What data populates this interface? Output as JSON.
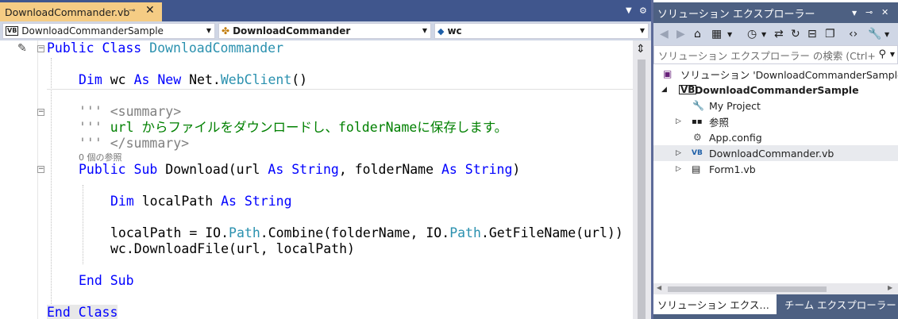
{
  "editor": {
    "tab": {
      "label": "DownloadCommander.vb",
      "pin_glyph": "⊸",
      "close_glyph": "✕"
    },
    "tabstrip_buttons": {
      "dropdown": "▼",
      "settings": "⚙"
    },
    "navbar": {
      "project_combo": "DownloadCommanderSample",
      "type_combo": "DownloadCommander",
      "member_combo": "wc"
    },
    "code": {
      "line1": {
        "kw": "Public Class",
        "type": "DownloadCommander"
      },
      "line2": {
        "kw1": "Dim",
        "var": " wc ",
        "kw2": "As New",
        "ns": " Net.",
        "type": "WebClient",
        "tail": "()"
      },
      "doc1": {
        "marker": "'''",
        "tag": " <summary>"
      },
      "doc2": {
        "marker": "'''",
        "text": " url からファイルをダウンロードし、folderNameに保存します。"
      },
      "doc3": {
        "marker": "'''",
        "tag": " </summary>"
      },
      "refcount": "0 個の参照",
      "line_sub": {
        "kw": "Public Sub",
        "name": " Download(url ",
        "kw2": "As",
        "t1": " String",
        "mid": ", folderName ",
        "kw3": "As",
        "t2": " String",
        "tail": ")"
      },
      "line_dim": {
        "kw": "Dim",
        "name": " localPath ",
        "kw2": "As",
        "t": " String"
      },
      "line_assign": {
        "a": "localPath = IO.",
        "t1": "Path",
        "b": ".Combine(folderName, IO.",
        "t2": "Path",
        "c": ".GetFileName(url))"
      },
      "line_call": "wc.DownloadFile(url, localPath)",
      "end_sub": "End Sub",
      "end_class": "End Class"
    }
  },
  "solution_explorer": {
    "title": "ソリューション エクスプローラー",
    "title_buttons": {
      "dropdown": "▼",
      "pin": "⊸",
      "close": "✕"
    },
    "search_placeholder": "ソリューション エクスプローラー の検索 (Ctrl+",
    "tree": {
      "solution": "ソリューション 'DownloadCommanderSample' (",
      "project": "DownloadCommanderSample",
      "my_project": "My Project",
      "references": "参照",
      "app_config": "App.config",
      "commander_file": "DownloadCommander.vb",
      "form1": "Form1.vb"
    },
    "bottom_tabs": {
      "solution_tab": "ソリューション エクス…",
      "team_tab": "チーム エクスプローラー"
    }
  },
  "colors": {
    "keyword": "#0000ff",
    "type": "#2b91af",
    "comment": "#008000",
    "active_tab": "#f5cc84",
    "titlebar": "#4d6082"
  }
}
